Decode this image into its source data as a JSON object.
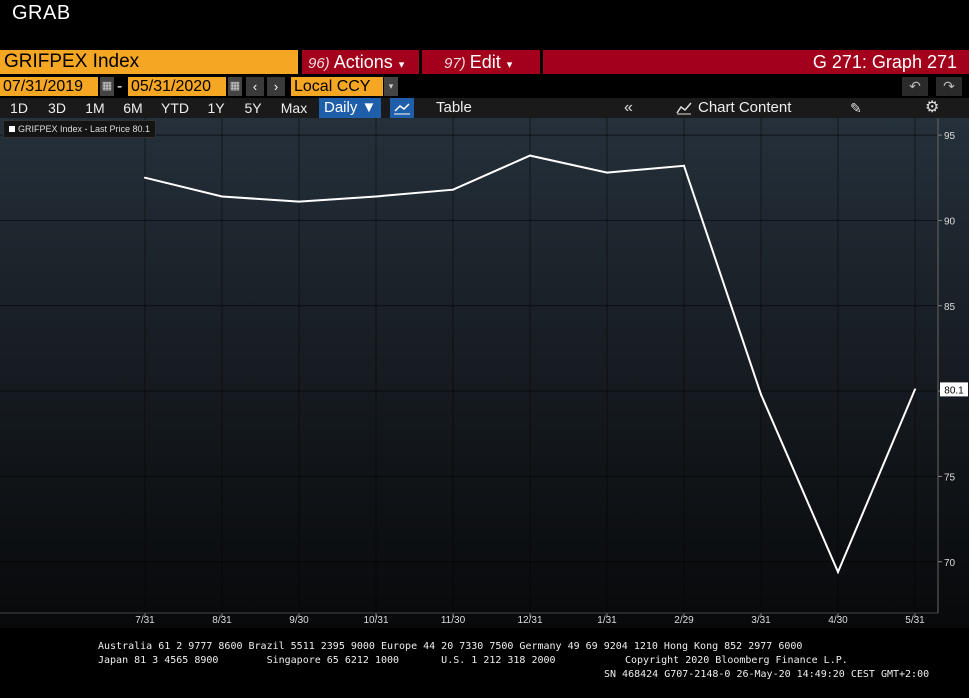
{
  "app": {
    "title": "GRAB"
  },
  "toolbar": {
    "ticker": "GRIFPEX Index",
    "actions": {
      "num": "96)",
      "label": "Actions"
    },
    "edit": {
      "num": "97)",
      "label": "Edit"
    },
    "graph_title": "G 271: Graph 271"
  },
  "dates": {
    "start": "07/31/2019",
    "end": "05/31/2020",
    "currency": "Local CCY"
  },
  "periods": [
    "1D",
    "3D",
    "1M",
    "6M",
    "YTD",
    "1Y",
    "5Y",
    "Max"
  ],
  "frequency": "Daily",
  "view": {
    "table_label": "Table",
    "chart_content_label": "Chart Content"
  },
  "legend": {
    "label": "GRIFPEX Index - Last Price 80.1"
  },
  "chart_data": {
    "type": "line",
    "x": [
      "7/31",
      "8/31",
      "9/30",
      "10/31",
      "11/30",
      "12/31",
      "1/31",
      "2/29",
      "3/31",
      "4/30",
      "5/31"
    ],
    "series": [
      {
        "name": "GRIFPEX Index - Last Price",
        "values": [
          92.5,
          91.4,
          91.1,
          91.4,
          91.8,
          93.8,
          92.8,
          93.2,
          79.8,
          69.4,
          80.1
        ]
      }
    ],
    "y_ticks": [
      95,
      90,
      85,
      80,
      75,
      70
    ],
    "ylim": [
      67,
      96
    ],
    "last_value_label": "80.1",
    "line_color": "#ffffff",
    "grid": true
  },
  "footer": {
    "line1": "Australia 61 2 9777 8600 Brazil 5511 2395 9000 Europe 44 20 7330 7500 Germany 49 69 9204 1210 Hong Kong 852 2977 6000",
    "line2a": "Japan 81 3 4565 8900        Singapore 65 6212 1000       U.S. 1 212 318 2000",
    "line2b": "Copyright 2020 Bloomberg Finance L.P.",
    "line3": "SN 468424 G707-2148-0 26-May-20 14:49:20 CEST GMT+2:00"
  },
  "colors": {
    "accent_orange": "#f5a623",
    "menu_red": "#a3001b",
    "selected_blue": "#1f5ea8"
  }
}
